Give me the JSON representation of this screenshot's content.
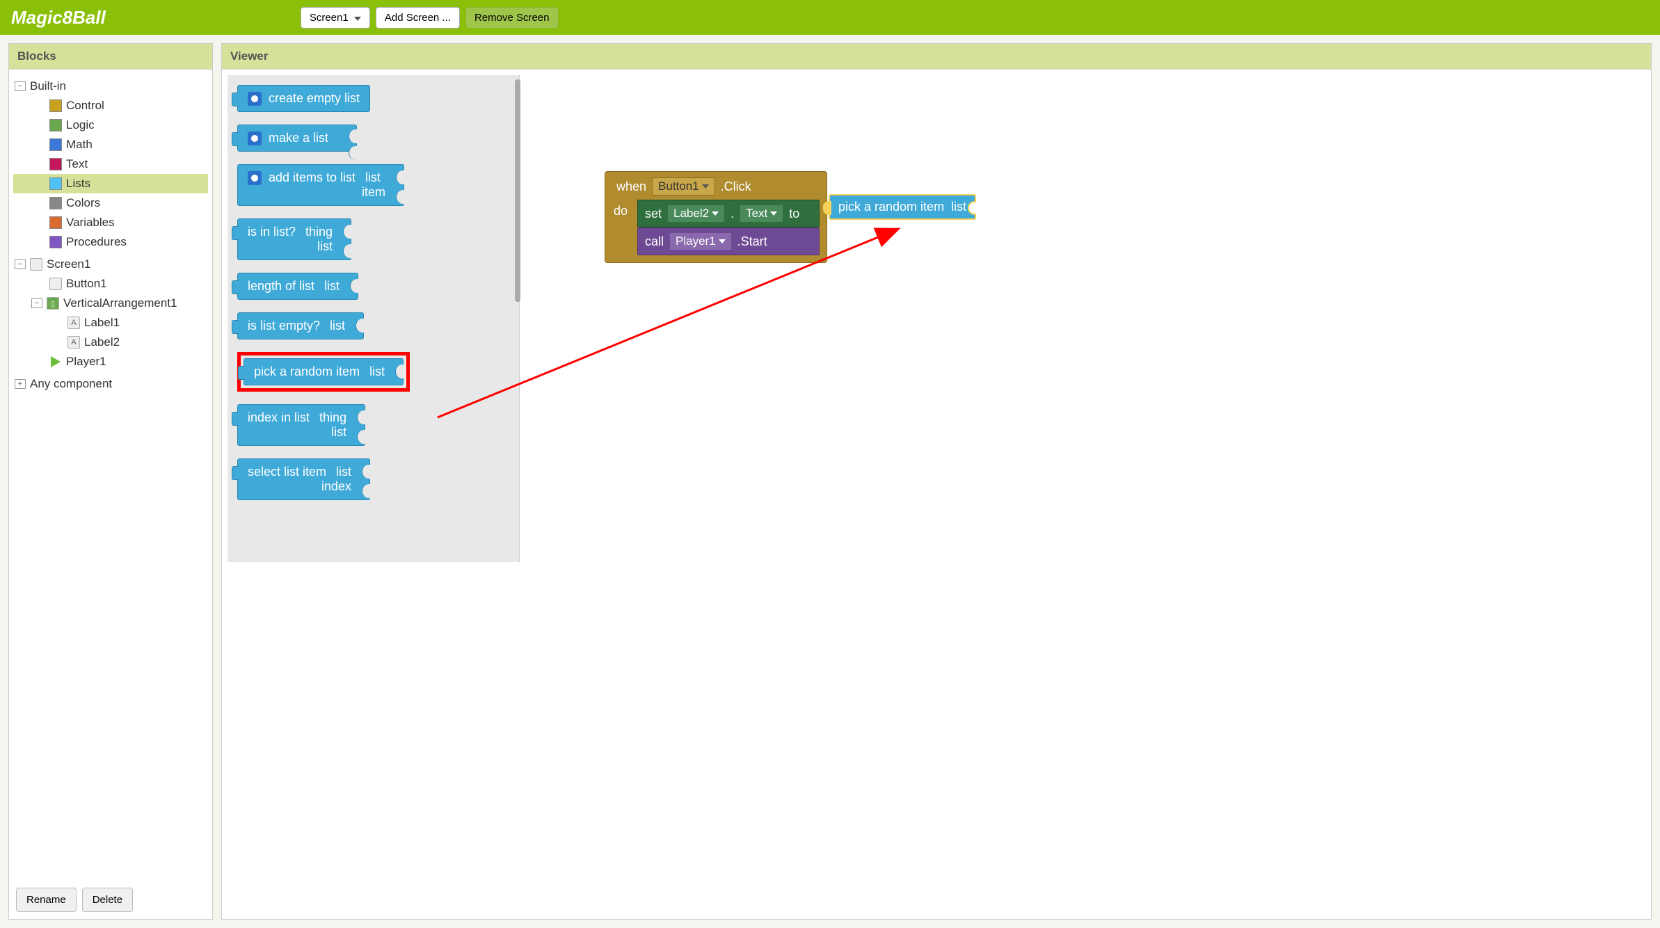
{
  "topbar": {
    "app_title": "Magic8Ball",
    "screen_btn": "Screen1",
    "add_screen": "Add Screen ...",
    "remove_screen": "Remove Screen"
  },
  "blocks_panel": {
    "title": "Blocks",
    "builtin_label": "Built-in",
    "categories": [
      {
        "name": "Control",
        "color": "#c8a21e"
      },
      {
        "name": "Logic",
        "color": "#6aa84f"
      },
      {
        "name": "Math",
        "color": "#3c78d8"
      },
      {
        "name": "Text",
        "color": "#c2185b"
      },
      {
        "name": "Lists",
        "color": "#4fc3f7"
      },
      {
        "name": "Colors",
        "color": "#888888"
      },
      {
        "name": "Variables",
        "color": "#d96b2e"
      },
      {
        "name": "Procedures",
        "color": "#7e57c2"
      }
    ],
    "screen_label": "Screen1",
    "components": [
      {
        "name": "Button1",
        "indent": 2,
        "icon": "btn"
      },
      {
        "name": "VerticalArrangement1",
        "indent": 2,
        "icon": "arr",
        "expandable": true
      },
      {
        "name": "Label1",
        "indent": 3,
        "icon": "A"
      },
      {
        "name": "Label2",
        "indent": 3,
        "icon": "A"
      },
      {
        "name": "Player1",
        "indent": 2,
        "icon": "play"
      }
    ],
    "any_component": "Any component",
    "rename_btn": "Rename",
    "delete_btn": "Delete"
  },
  "viewer": {
    "title": "Viewer"
  },
  "palette_blocks": {
    "create_empty": "create empty list",
    "make_list": "make a list",
    "add_items_l1": "add items to list",
    "add_items_list": "list",
    "add_items_item": "item",
    "is_in_list": "is in list?",
    "thing": "thing",
    "list_word": "list",
    "length_of": "length of list",
    "is_empty": "is list empty?",
    "pick_random": "pick a random item",
    "index_in": "index in list",
    "select_item": "select list item",
    "index_word": "index"
  },
  "workspace": {
    "when": "when",
    "button1": "Button1",
    "click": ".Click",
    "do": "do",
    "set": "set",
    "label2": "Label2",
    "dot": ".",
    "text": "Text",
    "to": "to",
    "call": "call",
    "player1": "Player1",
    "start": ".Start",
    "attached_pick": "pick a random item",
    "attached_list": "list"
  }
}
